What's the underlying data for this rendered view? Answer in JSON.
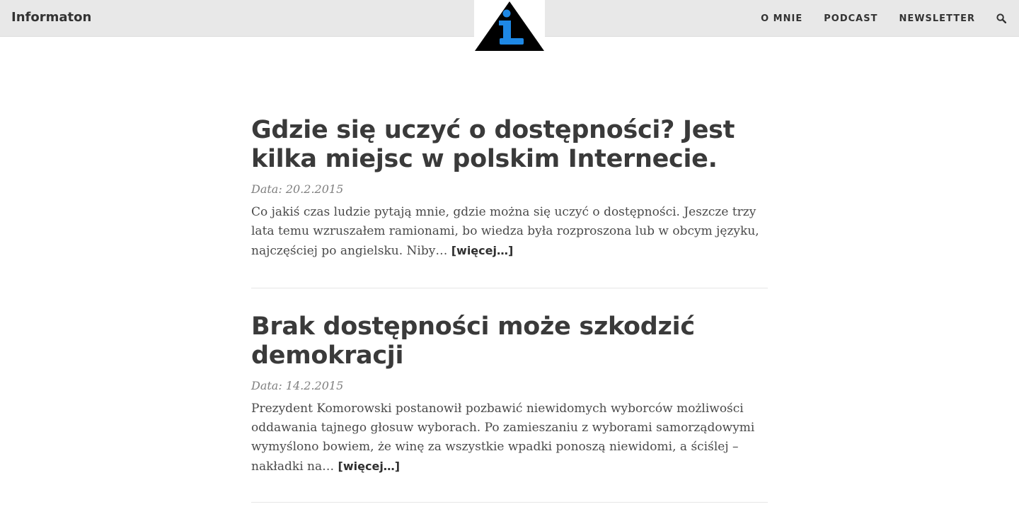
{
  "header": {
    "brand": "Informaton",
    "nav": [
      {
        "label": "O MNIE"
      },
      {
        "label": "PODCAST"
      },
      {
        "label": "NEWSLETTER"
      }
    ],
    "search_icon": "search-icon",
    "logo_icon": "info-triangle-icon"
  },
  "colors": {
    "topbar": "#e8e8e8",
    "logo_triangle": "#000000",
    "logo_i": "#1e88e5",
    "text": "#3a3a3a"
  },
  "posts": [
    {
      "title": "Gdzie się uczyć o dostępności? Jest kilka miejsc w polskim Internecie.",
      "date": "Data: 20.2.2015",
      "excerpt": "Co jakiś czas ludzie pytają mnie, gdzie można się uczyć o dostępności. Jeszcze trzy lata temu wzruszałem ramionami, bo wiedza była rozproszona lub w obcym języku, najczęściej po angielsku. Niby… ",
      "more": "[więcej…]"
    },
    {
      "title": "Brak dostępności może szkodzić demokracji",
      "date": "Data: 14.2.2015",
      "excerpt": "Prezydent Komorowski postanowił pozbawić niewidomych wyborców możliwości oddawania tajnego głosuw wyborach. Po zamieszaniu z wyborami samorządowymi wymyślono bowiem, że winę za wszystkie wpadki ponoszą niewidomi, a ściślej – nakładki na… ",
      "more": "[więcej…]"
    }
  ]
}
